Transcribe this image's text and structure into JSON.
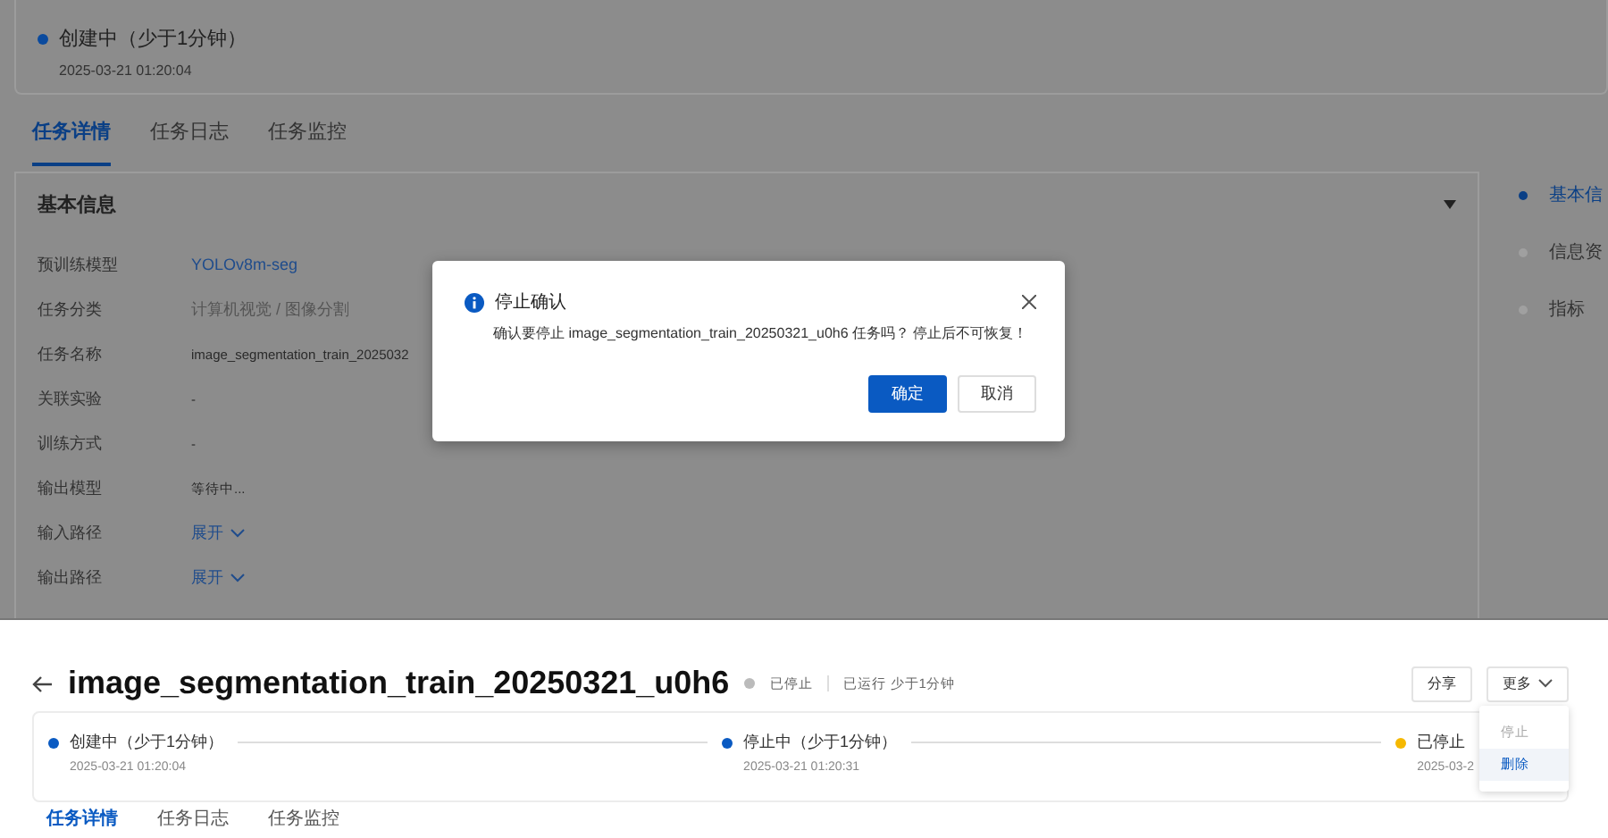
{
  "background_page": {
    "status_step": {
      "label": "创建中",
      "duration": "（少于1分钟）",
      "time": "2025-03-21 01:20:04",
      "color": "#0a4a9e"
    },
    "tabs": [
      {
        "label": "任务详情",
        "selected": true
      },
      {
        "label": "任务日志",
        "selected": false
      },
      {
        "label": "任务监控",
        "selected": false
      }
    ],
    "section_title": "基本信息",
    "details": [
      {
        "label": "预训练模型",
        "value": "YOLOv8m-seg",
        "kind": "link"
      },
      {
        "label": "任务分类",
        "value": "计算机视觉 / 图像分割",
        "kind": "muted"
      },
      {
        "label": "任务名称",
        "value": "image_segmentation_train_2025032",
        "kind": "text"
      },
      {
        "label": "关联实验",
        "value": "-",
        "kind": "text"
      },
      {
        "label": "训练方式",
        "value": "-",
        "kind": "text"
      },
      {
        "label": "输出模型",
        "value": "等待中...",
        "kind": "text"
      },
      {
        "label": "输入路径",
        "value": "展开",
        "kind": "expand"
      },
      {
        "label": "输出路径",
        "value": "展开",
        "kind": "expand"
      }
    ],
    "anchors": [
      {
        "label": "基本信",
        "selected": true
      },
      {
        "label": "信息资",
        "selected": false
      },
      {
        "label": "指标",
        "selected": false
      }
    ]
  },
  "dialog": {
    "title": "停止确认",
    "message": "确认要停止 image_segmentation_train_20250321_u0h6 任务吗？ 停止后不可恢复！",
    "buttons": [
      {
        "label": "确定",
        "kind": "primary"
      },
      {
        "label": "取消",
        "kind": "default"
      }
    ]
  },
  "task_page": {
    "title": "image_segmentation_train_20250321_u0h6",
    "status": "已停止",
    "runtime": "已运行 少于1分钟",
    "actions": [
      {
        "label": "分享",
        "kind": "plain"
      },
      {
        "label": "更多",
        "kind": "dropdown"
      }
    ],
    "menu": [
      {
        "label": "停止",
        "disabled": true,
        "highlighted": false
      },
      {
        "label": "删除",
        "disabled": false,
        "highlighted": true
      }
    ],
    "steps": [
      {
        "label": "创建中",
        "duration": "（少于1分钟）",
        "time": "2025-03-21 01:20:04",
        "color": "#0a5ac2"
      },
      {
        "label": "停止中",
        "duration": "（少于1分钟）",
        "time": "2025-03-21 01:20:31",
        "color": "#0a5ac2"
      },
      {
        "label": "已停止",
        "time": "2025-03-2",
        "color": "#f5b800"
      }
    ],
    "tabs": [
      {
        "label": "任务详情",
        "selected": true
      },
      {
        "label": "任务日志",
        "selected": false
      },
      {
        "label": "任务监控",
        "selected": false
      }
    ]
  }
}
